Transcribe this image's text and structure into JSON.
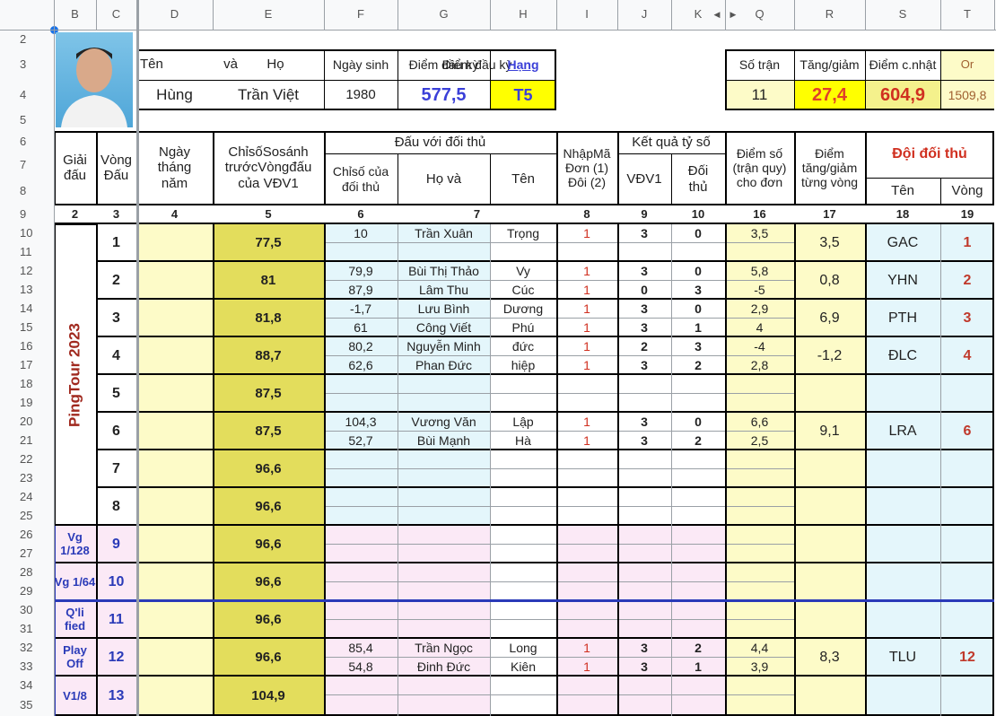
{
  "col_headers": [
    "B",
    "C",
    "D",
    "E",
    "F",
    "G",
    "H",
    "I",
    "J",
    "K",
    "Q",
    "R",
    "S",
    "T"
  ],
  "row_numbers": [
    "2",
    "3",
    "4",
    "5",
    "6",
    "7",
    "8",
    "9",
    "10",
    "11",
    "12",
    "13",
    "14",
    "15",
    "16",
    "17",
    "18",
    "19",
    "20",
    "21",
    "22",
    "23",
    "24",
    "25",
    "26",
    "27",
    "28",
    "29",
    "30",
    "31",
    "32",
    "33",
    "34",
    "35"
  ],
  "player": {
    "header": {
      "ten": "Tên",
      "va": "và",
      "ho": "Họ",
      "ngay_sinh": "Ngày sinh",
      "diem_dau_ky": "Điểm đầu kỳ",
      "hang": "Hạng"
    },
    "ten": "Hùng",
    "ho": "Trần Việt",
    "nam_sinh": "1980",
    "diem_dau_ky": "577,5",
    "hang": "T5"
  },
  "summary": {
    "so_tran_label": "Số trận",
    "tang_giam_label": "Tăng/giảm",
    "diem_cnhat_label": "Điểm c.nhật",
    "or_label": "Or",
    "so_tran": "11",
    "tang_giam": "27,4",
    "diem_cnhat": "604,9",
    "or": "1509,8"
  },
  "table_header": {
    "giai_dau": "Giải đấu",
    "vong_dau": "Vòng Đấu",
    "ngay_thang_nam": "Ngày tháng năm",
    "chiso_sosanh": "ChỉsốSosánh trướcVòngđấu của VĐV1",
    "dau_voi_doi_thu": "Đấu với đối thủ",
    "chiso_doithu": "Chỉsố của đối thủ",
    "ho_va": "Họ và",
    "ten": "Tên",
    "nhap_ma": "NhậpMã Đơn (1) Đôi (2)",
    "ket_qua": "Kết quả tỷ số",
    "vdv1": "VĐV1",
    "doi_thu": "Đối thủ",
    "diem_so": "Điểm số (trận quy) cho đơn",
    "diem_tang_giam": "Điểm tăng/giảm từng vòng",
    "doi_doi_thu": "Đội đối thủ",
    "ten2": "Tên",
    "vong": "Vòng"
  },
  "index_row": [
    "2",
    "3",
    "4",
    "5",
    "6",
    "7",
    "8",
    "9",
    "10",
    "16",
    "17",
    "18",
    "19"
  ],
  "tournament_label": "PingTour 2023",
  "rounds": [
    {
      "vong": "1",
      "chiso": "77,5",
      "lines": [
        {
          "cs": "10",
          "ho": "Trần Xuân",
          "ten": "Trọng",
          "ma": "1",
          "a": "3",
          "b": "0",
          "diem": "3,5"
        },
        {
          "cs": "",
          "ho": "",
          "ten": "",
          "ma": "",
          "a": "",
          "b": "",
          "diem": ""
        }
      ],
      "tg": "3,5",
      "doi": "GAC",
      "v": "1"
    },
    {
      "vong": "2",
      "chiso": "81",
      "lines": [
        {
          "cs": "79,9",
          "ho": "Bùi Thị Thảo",
          "ten": "Vy",
          "ma": "1",
          "a": "3",
          "b": "0",
          "diem": "5,8"
        },
        {
          "cs": "87,9",
          "ho": "Lâm Thu",
          "ten": "Cúc",
          "ma": "1",
          "a": "0",
          "b": "3",
          "diem": "-5"
        }
      ],
      "tg": "0,8",
      "doi": "YHN",
      "v": "2"
    },
    {
      "vong": "3",
      "chiso": "81,8",
      "lines": [
        {
          "cs": "-1,7",
          "ho": "Lưu Bình",
          "ten": "Dương",
          "ma": "1",
          "a": "3",
          "b": "0",
          "diem": "2,9"
        },
        {
          "cs": "61",
          "ho": "Công Viết",
          "ten": "Phú",
          "ma": "1",
          "a": "3",
          "b": "1",
          "diem": "4"
        }
      ],
      "tg": "6,9",
      "doi": "PTH",
      "v": "3"
    },
    {
      "vong": "4",
      "chiso": "88,7",
      "lines": [
        {
          "cs": "80,2",
          "ho": "Nguyễn Minh",
          "ten": "đức",
          "ma": "1",
          "a": "2",
          "b": "3",
          "diem": "-4"
        },
        {
          "cs": "62,6",
          "ho": "Phan Đức",
          "ten": "hiệp",
          "ma": "1",
          "a": "3",
          "b": "2",
          "diem": "2,8"
        }
      ],
      "tg": "-1,2",
      "doi": "ĐLC",
      "v": "4"
    },
    {
      "vong": "5",
      "chiso": "87,5",
      "lines": [
        {
          "cs": "",
          "ho": "",
          "ten": "",
          "ma": "",
          "a": "",
          "b": "",
          "diem": ""
        },
        {
          "cs": "",
          "ho": "",
          "ten": "",
          "ma": "",
          "a": "",
          "b": "",
          "diem": ""
        }
      ],
      "tg": "",
      "doi": "",
      "v": ""
    },
    {
      "vong": "6",
      "chiso": "87,5",
      "lines": [
        {
          "cs": "104,3",
          "ho": "Vương Văn",
          "ten": "Lập",
          "ma": "1",
          "a": "3",
          "b": "0",
          "diem": "6,6"
        },
        {
          "cs": "52,7",
          "ho": "Bùi Mạnh",
          "ten": "Hà",
          "ma": "1",
          "a": "3",
          "b": "2",
          "diem": "2,5"
        }
      ],
      "tg": "9,1",
      "doi": "LRA",
      "v": "6"
    },
    {
      "vong": "7",
      "chiso": "96,6",
      "lines": [
        {
          "cs": "",
          "ho": "",
          "ten": "",
          "ma": "",
          "a": "",
          "b": "",
          "diem": ""
        },
        {
          "cs": "",
          "ho": "",
          "ten": "",
          "ma": "",
          "a": "",
          "b": "",
          "diem": ""
        }
      ],
      "tg": "",
      "doi": "",
      "v": ""
    },
    {
      "vong": "8",
      "chiso": "96,6",
      "lines": [
        {
          "cs": "",
          "ho": "",
          "ten": "",
          "ma": "",
          "a": "",
          "b": "",
          "diem": ""
        },
        {
          "cs": "",
          "ho": "",
          "ten": "",
          "ma": "",
          "a": "",
          "b": "",
          "diem": ""
        }
      ],
      "tg": "",
      "doi": "",
      "v": ""
    },
    {
      "label": "Vg 1/128",
      "vong": "9",
      "chiso": "96,6",
      "lines": [
        {
          "cs": "",
          "ho": "",
          "ten": "",
          "ma": "",
          "a": "",
          "b": "",
          "diem": ""
        },
        {
          "cs": "",
          "ho": "",
          "ten": "",
          "ma": "",
          "a": "",
          "b": "",
          "diem": ""
        }
      ],
      "tg": "",
      "doi": "",
      "v": ""
    },
    {
      "label": "Vg 1/64",
      "vong": "10",
      "chiso": "96,6",
      "lines": [
        {
          "cs": "",
          "ho": "",
          "ten": "",
          "ma": "",
          "a": "",
          "b": "",
          "diem": ""
        },
        {
          "cs": "",
          "ho": "",
          "ten": "",
          "ma": "",
          "a": "",
          "b": "",
          "diem": ""
        }
      ],
      "tg": "",
      "doi": "",
      "v": ""
    },
    {
      "label": "Q'li fied",
      "vong": "11",
      "chiso": "96,6",
      "lines": [
        {
          "cs": "",
          "ho": "",
          "ten": "",
          "ma": "",
          "a": "",
          "b": "",
          "diem": ""
        },
        {
          "cs": "",
          "ho": "",
          "ten": "",
          "ma": "",
          "a": "",
          "b": "",
          "diem": ""
        }
      ],
      "tg": "",
      "doi": "",
      "v": ""
    },
    {
      "label": "Play Off",
      "vong": "12",
      "chiso": "96,6",
      "lines": [
        {
          "cs": "85,4",
          "ho": "Trần Ngọc",
          "ten": "Long",
          "ma": "1",
          "a": "3",
          "b": "2",
          "diem": "4,4"
        },
        {
          "cs": "54,8",
          "ho": "Đinh Đức",
          "ten": "Kiên",
          "ma": "1",
          "a": "3",
          "b": "1",
          "diem": "3,9"
        }
      ],
      "tg": "8,3",
      "doi": "TLU",
      "v": "12"
    },
    {
      "label": "V1/8",
      "vong": "13",
      "chiso": "104,9",
      "lines": [
        {
          "cs": "",
          "ho": "",
          "ten": "",
          "ma": "",
          "a": "",
          "b": "",
          "diem": ""
        },
        {
          "cs": "",
          "ho": "",
          "ten": "",
          "ma": "",
          "a": "",
          "b": "",
          "diem": ""
        }
      ],
      "tg": "",
      "doi": "",
      "v": ""
    }
  ],
  "colors": {
    "yellow": "#f4f18c",
    "light_yellow": "#fdfbc8",
    "olive": "#e3dd5c",
    "light_blue": "#e4f6fb",
    "light_pink": "#fbe9f6",
    "red": "#c0392b",
    "blue_text": "#3a3fd8",
    "dark_blue": "#2a3ab8"
  }
}
